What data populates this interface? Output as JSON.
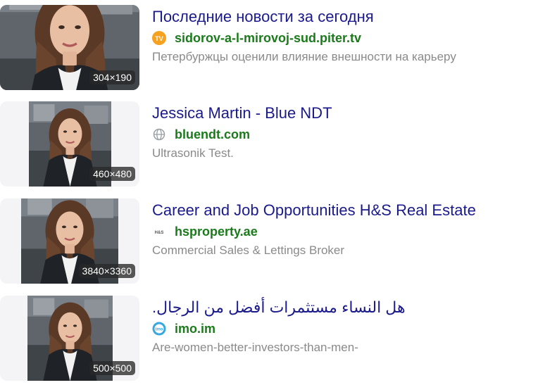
{
  "results": [
    {
      "title": "Последние новости за сегодня",
      "domain": "sidorov-a-l-mirovoj-sud.piter.tv",
      "favicon": "tv-icon",
      "favicon_text": "TV",
      "description": "Петербуржцы оценили влияние внешности на карьеру",
      "size": "304×190"
    },
    {
      "title": "Jessica Martin - Blue NDT",
      "domain": "bluendt.com",
      "favicon": "globe-icon",
      "description": "Ultrasonik Test.",
      "size": "460×480"
    },
    {
      "title": "Career and Job Opportunities H&S Real Estate",
      "domain": "hsproperty.ae",
      "favicon": "hs-logo-icon",
      "favicon_text": "H&S",
      "description": "Commercial Sales & Lettings Broker",
      "size": "3840×3360"
    },
    {
      "title": "هل النساء مستثمرات أفضل من الرجال.",
      "domain": "imo.im",
      "favicon": "imo-icon",
      "favicon_text": "imo",
      "description": "Are-women-better-investors-than-men-",
      "size": "500×500"
    }
  ],
  "colors": {
    "title": "#1a1a8c",
    "domain": "#1b7a1b",
    "description": "#8a8a8a",
    "tv_icon": "#f6a21e",
    "imo_icon": "#37a7e0"
  }
}
